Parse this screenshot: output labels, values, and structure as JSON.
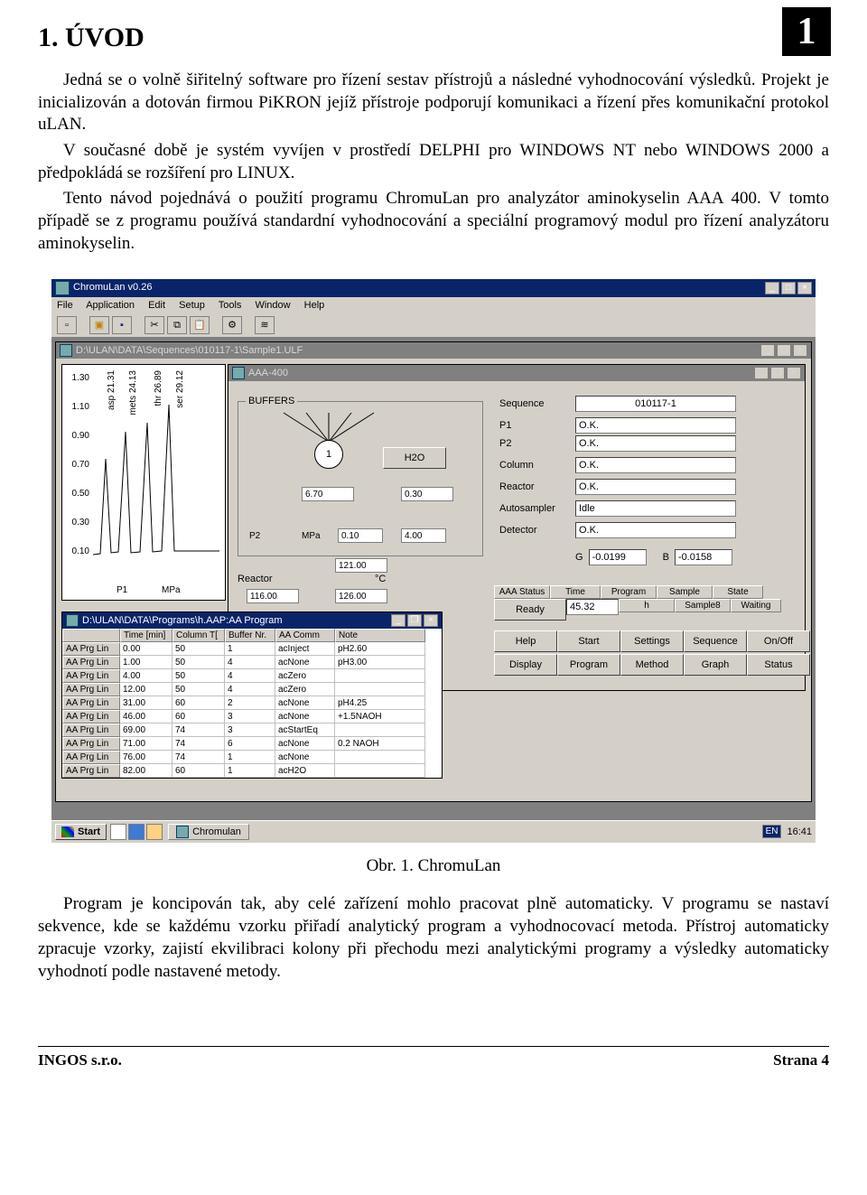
{
  "heading": "1. ÚVOD",
  "chapnum": "1",
  "para1": "Jedná se o volně šiřitelný software pro řízení sestav přístrojů a následné vyhodnocování výsledků. Projekt je inicializován a dotován firmou PiKRON jejíž přístroje podporují komunikaci a řízení přes komunikační protokol uLAN.",
  "para2": "V současné době je systém vyvíjen v prostředí DELPHI pro WINDOWS NT nebo WINDOWS 2000 a předpokládá se rozšíření pro LINUX.",
  "para3": "Tento návod pojednává o použití programu ChromuLan pro analyzátor aminokyselin AAA 400. V tomto případě se z programu používá standardní vyhodnocování a speciální programový modul pro řízení analyzátoru aminokyselin.",
  "caption": "Obr. 1. ChromuLan",
  "para4": "Program je koncipován tak, aby celé zařízení mohlo pracovat plně automaticky. V programu se nastaví sekvence, kde se každému vzorku přiřadí analytický program a vyhodnocovací metoda. Přístroj automaticky zpracuje vzorky, zajistí ekvilibraci kolony při přechodu mezi analytickými programy a výsledky automaticky vyhodnotí podle nastavené metody.",
  "footer_left": "INGOS s.r.o.",
  "footer_right": "Strana 4",
  "app": {
    "title": "ChromuLan v0.26",
    "menu": [
      "File",
      "Application",
      "Edit",
      "Setup",
      "Tools",
      "Window",
      "Help"
    ],
    "seq_path": "D:\\ULAN\\DATA\\Sequences\\010117-1\\Sample1.ULF",
    "aaa_title": "AAA-400",
    "prg_path": "D:\\ULAN\\DATA\\Programs\\h.AAP:AA Program"
  },
  "chart_data": {
    "type": "line",
    "yticks": [
      "1.30",
      "1.10",
      "0.90",
      "0.70",
      "0.50",
      "0.30",
      "0.10"
    ],
    "peaks": [
      {
        "label": "asp",
        "rt": "21.31"
      },
      {
        "label": "mets",
        "rt": "24.13"
      },
      {
        "label": "thr",
        "rt": "26.89"
      },
      {
        "label": "ser",
        "rt": "29.12"
      }
    ],
    "axis_labels": {
      "p1": "P1",
      "p1u": "MPa",
      "p2": "P2",
      "p2u": "MPa"
    }
  },
  "buffers": {
    "title": "BUFFERS",
    "sel": "1",
    "h2o": "H2O",
    "val_a": "6.70",
    "val_b": "0.30",
    "val_c": "0.10",
    "val_d": "4.00",
    "reactor_lbl": "Reactor",
    "reactor_unit": "°C",
    "reactor_a": "116.00",
    "reactor_b": "126.00",
    "col_val": "121.00"
  },
  "status_fields": [
    {
      "label": "Sequence",
      "value": "010117-1"
    },
    {
      "label": "P1",
      "value": "O.K."
    },
    {
      "label": "P2",
      "value": "O.K."
    },
    {
      "label": "Column",
      "value": "O.K."
    },
    {
      "label": "Reactor",
      "value": "O.K."
    },
    {
      "label": "Autosampler",
      "value": "Idle"
    },
    {
      "label": "Detector",
      "value": "O.K."
    }
  ],
  "gb": {
    "g_lab": "G",
    "g": "-0.0199",
    "b_lab": "B",
    "b": "-0.0158"
  },
  "aaa_status": {
    "headers": [
      "AAA Status",
      "Time",
      "Program",
      "Sample",
      "State"
    ],
    "values": [
      "Ready",
      "45.32",
      "h",
      "Sample8",
      "Waiting"
    ]
  },
  "btnrow1": [
    "Help",
    "Start",
    "Settings",
    "Sequence",
    "On/Off"
  ],
  "btnrow2": [
    "Display",
    "Program",
    "Method",
    "Graph",
    "Status"
  ],
  "prg": {
    "headers": [
      "",
      "Time [min]",
      "Column T[",
      "Buffer Nr.",
      "AA Comm",
      "Note"
    ],
    "rows": [
      [
        "AA Prg Lin",
        "0.00",
        "50",
        "1",
        "acInject",
        "pH2.60"
      ],
      [
        "AA Prg Lin",
        "1.00",
        "50",
        "4",
        "acNone",
        "pH3.00"
      ],
      [
        "AA Prg Lin",
        "4.00",
        "50",
        "4",
        "acZero",
        ""
      ],
      [
        "AA Prg Lin",
        "12.00",
        "50",
        "4",
        "acZero",
        ""
      ],
      [
        "AA Prg Lin",
        "31.00",
        "60",
        "2",
        "acNone",
        "pH4.25"
      ],
      [
        "AA Prg Lin",
        "46.00",
        "60",
        "3",
        "acNone",
        "+1.5NAOH"
      ],
      [
        "AA Prg Lin",
        "69.00",
        "74",
        "3",
        "acStartEq",
        ""
      ],
      [
        "AA Prg Lin",
        "71.00",
        "74",
        "6",
        "acNone",
        "0.2 NAOH"
      ],
      [
        "AA Prg Lin",
        "76.00",
        "74",
        "1",
        "acNone",
        ""
      ],
      [
        "AA Prg Lin",
        "82.00",
        "60",
        "1",
        "acH2O",
        ""
      ]
    ]
  },
  "taskbar": {
    "start": "Start",
    "app": "Chromulan",
    "lang": "EN",
    "clock": "16:41"
  }
}
